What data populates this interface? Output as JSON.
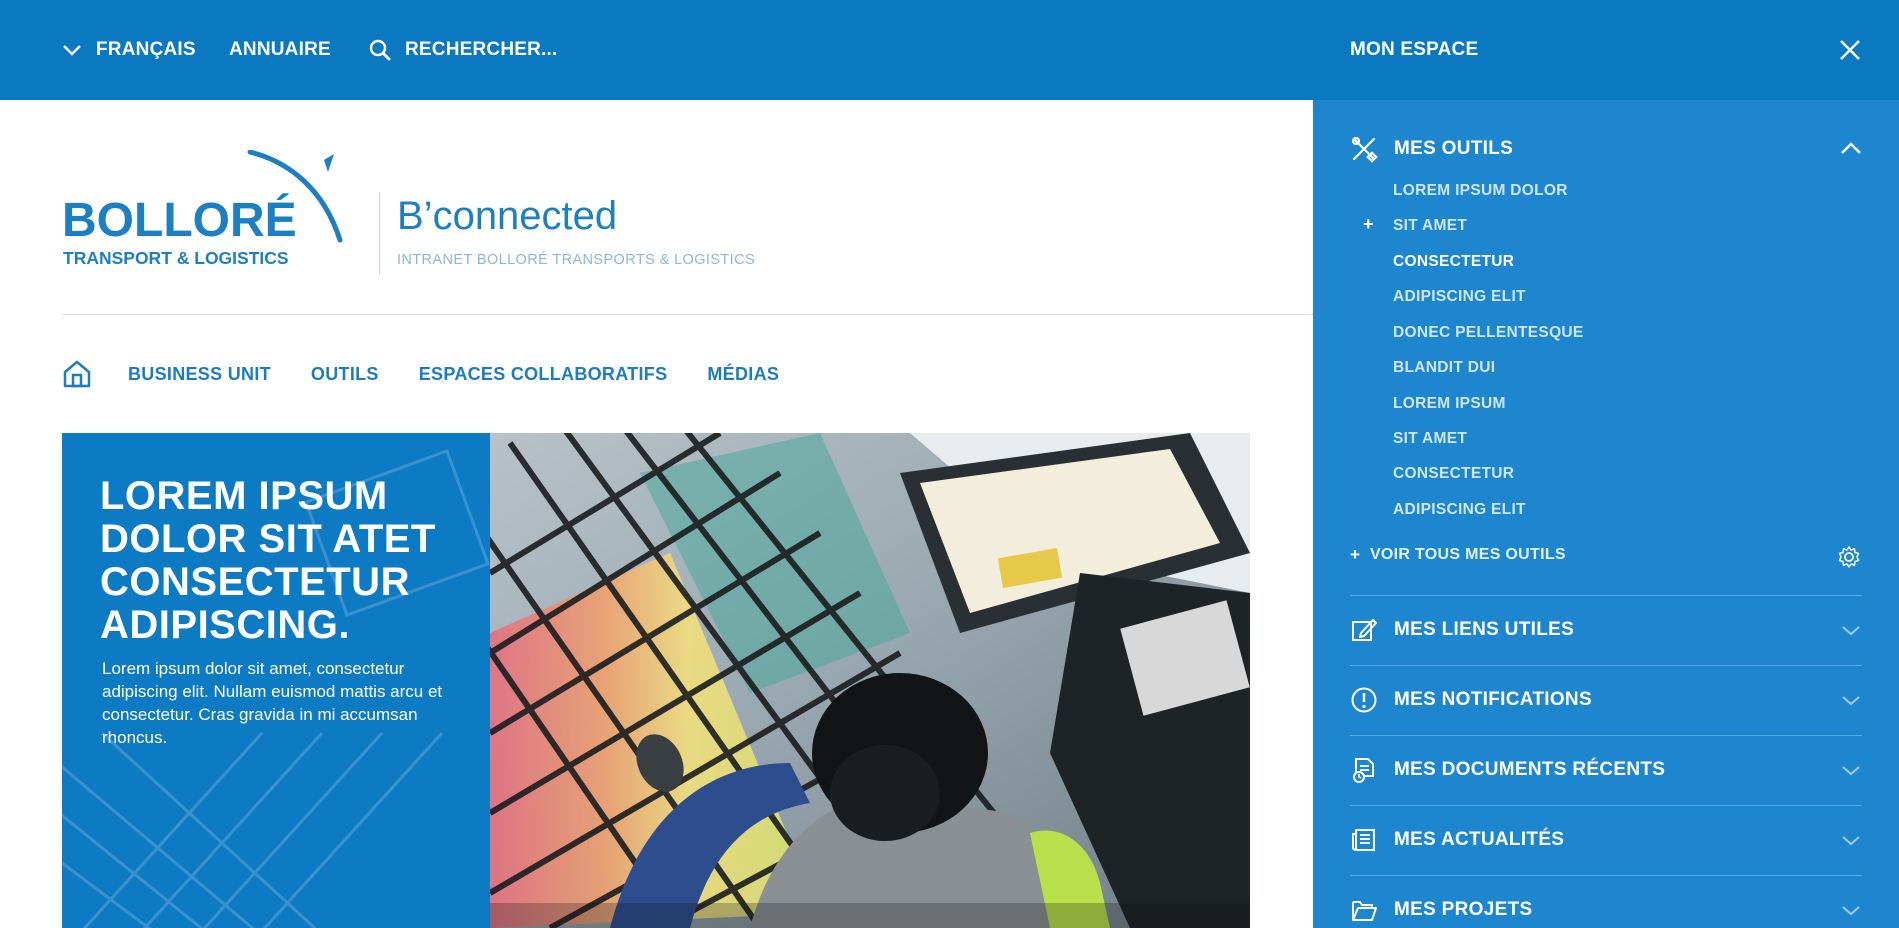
{
  "topbar": {
    "language_label": "FRANÇAIS",
    "directory_label": "ANNUAIRE",
    "search_placeholder": "RECHERCHER...",
    "my_space_label": "MON ESPACE"
  },
  "brand": {
    "logo_name": "BOLLORÉ",
    "logo_sub": "TRANSPORT & LOGISTICS",
    "title": "B’connected",
    "subtitle": "INTRANET BOLLORÉ TRANSPORTS & LOGISTICS"
  },
  "nav": {
    "items": [
      {
        "label": "BUSINESS UNIT"
      },
      {
        "label": "OUTILS"
      },
      {
        "label": "ESPACES COLLABORATIFS"
      },
      {
        "label": "MÉDIAS"
      }
    ]
  },
  "hero": {
    "title": "LOREM IPSUM DOLOR SIT ATET CONSECTETUR ADIPISCING.",
    "body": "Lorem ipsum dolor sit amet, consectetur adipiscing elit. Nullam euismod mattis arcu et consectetur. Cras gravida in mi accumsan rhoncus."
  },
  "panel": {
    "tools_title": "MES OUTILS",
    "tools": [
      {
        "label": "LOREM IPSUM DOLOR",
        "active": false
      },
      {
        "label": "SIT AMET",
        "active": false
      },
      {
        "label": "CONSECTETUR",
        "active": true
      },
      {
        "label": "ADIPISCING ELIT",
        "active": false
      },
      {
        "label": "DONEC PELLENTESQUE",
        "active": false
      },
      {
        "label": "BLANDIT DUI",
        "active": false
      },
      {
        "label": "LOREM IPSUM",
        "active": false
      },
      {
        "label": "SIT AMET",
        "active": false
      },
      {
        "label": "CONSECTETUR",
        "active": false
      },
      {
        "label": "ADIPISCING ELIT",
        "active": false
      }
    ],
    "see_all_label": "VOIR TOUS MES OUTILS",
    "sections": [
      {
        "label": "MES LIENS UTILES",
        "icon": "edit-icon"
      },
      {
        "label": "MES NOTIFICATIONS",
        "icon": "alert-icon"
      },
      {
        "label": "MES DOCUMENTS RÉCENTS",
        "icon": "documents-icon"
      },
      {
        "label": "MES ACTUALITÉS",
        "icon": "newspaper-icon"
      },
      {
        "label": "MES PROJETS",
        "icon": "folder-icon"
      }
    ]
  },
  "colors": {
    "topbar": "#0a79c1",
    "panel": "#1d86cf",
    "brand_blue": "#1d7fc3",
    "hero_blue": "#0d7ac4"
  }
}
